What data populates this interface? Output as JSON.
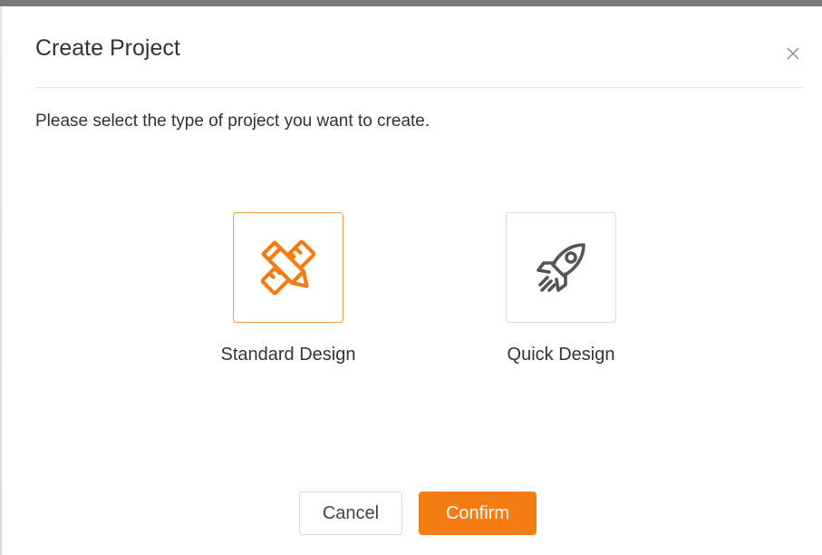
{
  "dialog": {
    "title": "Create Project",
    "close_glyph": "×",
    "prompt": "Please select the type of project you want to create."
  },
  "options": [
    {
      "label": "Standard Design",
      "icon": "pencil-ruler-icon",
      "selected": true
    },
    {
      "label": "Quick Design",
      "icon": "rocket-icon",
      "selected": false
    }
  ],
  "footer": {
    "cancel_label": "Cancel",
    "confirm_label": "Confirm"
  },
  "colors": {
    "accent": "#f57c12",
    "selected_border": "#f0a04b",
    "icon_gray": "#555555"
  }
}
